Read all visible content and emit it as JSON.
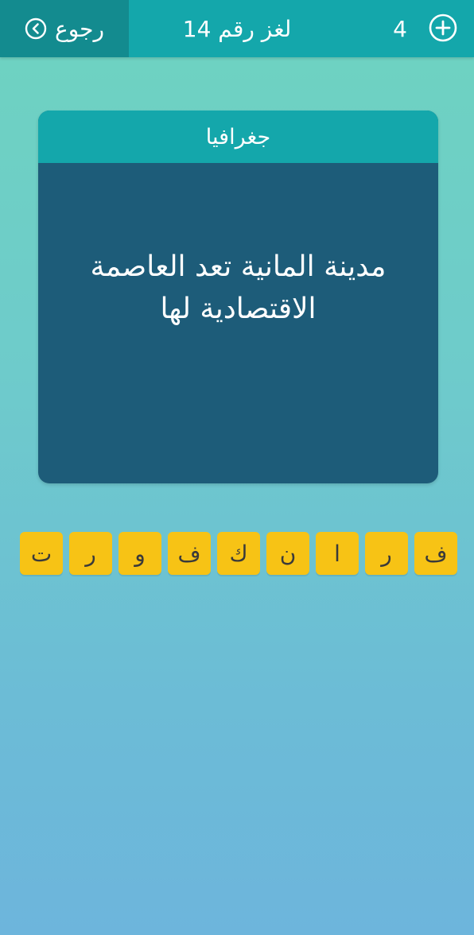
{
  "header": {
    "back_label": "رجوع",
    "level_title": "لغز رقم 14",
    "coins": "4"
  },
  "card": {
    "category": "جغرافيا",
    "question": "مدينة المانية تعد العاصمة الاقتصادية لها"
  },
  "letters": [
    "ف",
    "ر",
    "ا",
    "ن",
    "ك",
    "ف",
    "و",
    "ر",
    "ت"
  ],
  "colors": {
    "topbar": "#14a7ab",
    "back_button": "#138b8f",
    "card_body": "#1d5c79",
    "tile": "#f7c315"
  },
  "icons": {
    "back": "chevron-left-circle-icon",
    "add": "plus-circle-icon"
  }
}
